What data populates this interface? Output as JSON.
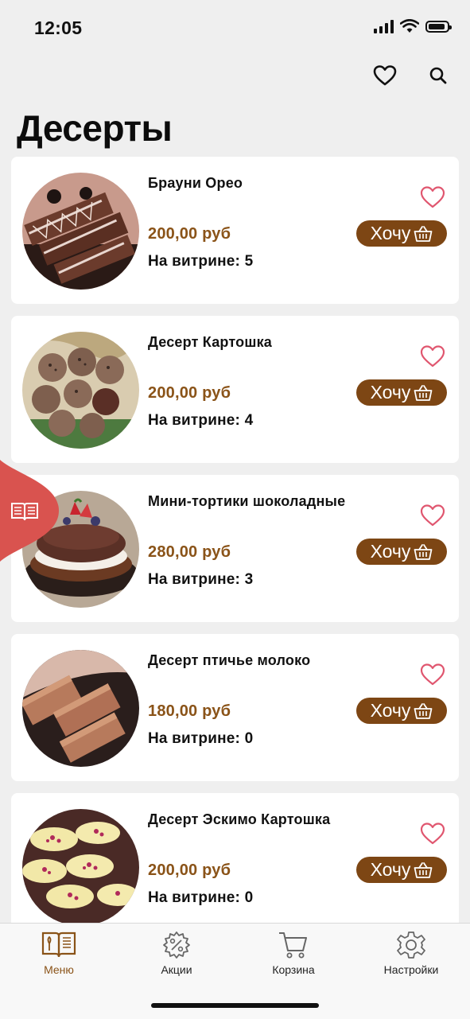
{
  "status": {
    "time": "12:05"
  },
  "page": {
    "title": "Десерты"
  },
  "icons": {
    "favorites": "heart-outline-icon",
    "search": "search-icon",
    "basket": "basket-icon",
    "menu_book": "menu-book-icon",
    "promo": "promo-gear-icon",
    "cart": "cart-icon",
    "settings": "gear-icon"
  },
  "colors": {
    "accent_brown": "#7d4614",
    "price_brown": "#8a5318",
    "heart_pink": "#e0566f",
    "side_tab_red": "#d9534f"
  },
  "products": [
    {
      "name": "Брауни Орео",
      "price": "200,00 руб",
      "stock": "На витрине: 5",
      "want_label": "Хочу"
    },
    {
      "name": "Десерт Картошка",
      "price": "200,00 руб",
      "stock": "На витрине: 4",
      "want_label": "Хочу"
    },
    {
      "name": "Мини-тортики шоколадные",
      "price": "280,00 руб",
      "stock": "На витрине: 3",
      "want_label": "Хочу"
    },
    {
      "name": "Десерт птичье молоко",
      "price": "180,00 руб",
      "stock": "На витрине: 0",
      "want_label": "Хочу"
    },
    {
      "name": "Десерт Эскимо Картошка",
      "price": "200,00 руб",
      "stock": "На витрине: 0",
      "want_label": "Хочу"
    }
  ],
  "nav": {
    "items": [
      {
        "label": "Меню",
        "active": true
      },
      {
        "label": "Акции",
        "active": false
      },
      {
        "label": "Корзина",
        "active": false
      },
      {
        "label": "Настройки",
        "active": false
      }
    ]
  }
}
